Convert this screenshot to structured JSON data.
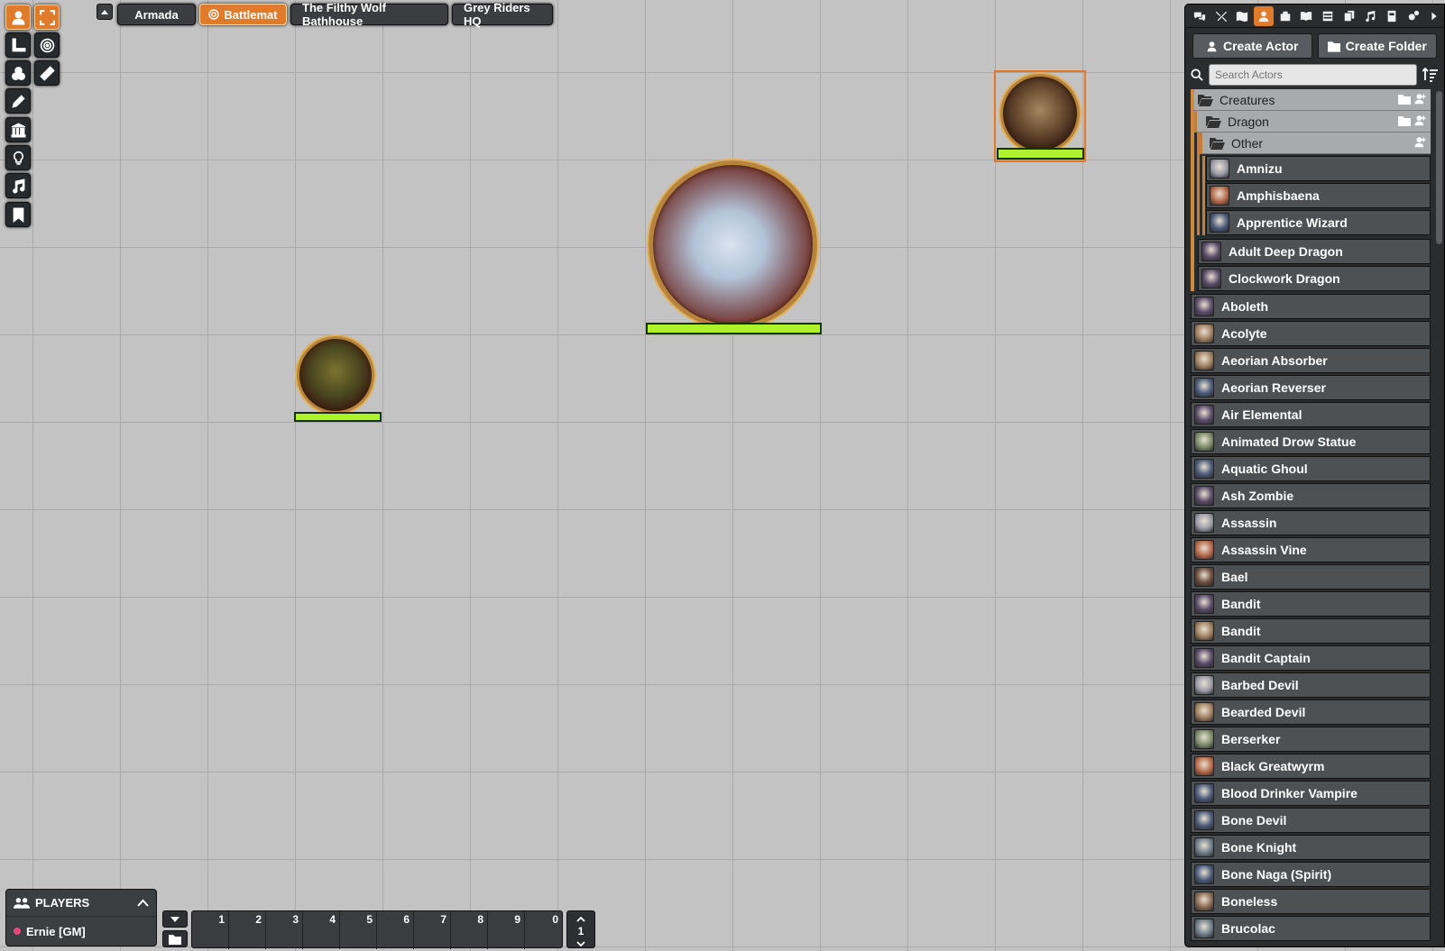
{
  "scene_nav": {
    "tabs": [
      {
        "label": "Armada",
        "active": false
      },
      {
        "label": "Battlemat",
        "active": true
      },
      {
        "label": "The Filthy Wolf Bathhouse",
        "active": false
      },
      {
        "label": "Grey Riders HQ",
        "active": false
      }
    ]
  },
  "controls": [
    {
      "icon": "user-icon",
      "active": true
    },
    {
      "icon": "expand-icon",
      "active": true
    },
    {
      "icon": "measure-icon",
      "active": false
    },
    {
      "icon": "target-icon",
      "active": false
    },
    {
      "icon": "shapes-icon",
      "active": false
    },
    {
      "icon": "ruler-icon",
      "active": false
    },
    {
      "icon": "pencil-icon",
      "active": false
    },
    {
      "icon": "landmark-icon",
      "active": false
    },
    {
      "icon": "lightbulb-icon",
      "active": false
    },
    {
      "icon": "music-icon",
      "active": false
    },
    {
      "icon": "bookmark-icon",
      "active": false
    }
  ],
  "sidebar": {
    "tab_icons": [
      "comments-icon",
      "combat-icon",
      "map-icon",
      "actors-icon",
      "items-icon",
      "journal-icon",
      "tables-icon",
      "cards-icon",
      "playlists-icon",
      "compendium-icon",
      "settings-icon",
      "collapse-icon"
    ],
    "active_tab": "actors-icon",
    "create_actor": "Create Actor",
    "create_folder": "Create Folder",
    "search_placeholder": "Search Actors",
    "folders": {
      "creatures": "Creatures",
      "dragon": "Dragon",
      "other": "Other"
    },
    "other_entries": [
      "Amnizu",
      "Amphisbaena",
      "Apprentice Wizard"
    ],
    "dragon_entries": [
      "Adult Deep Dragon",
      "Clockwork Dragon"
    ],
    "creature_entries": [
      "Aboleth",
      "Acolyte",
      "Aeorian Absorber",
      "Aeorian Reverser",
      "Air Elemental",
      "Animated Drow Statue",
      "Aquatic Ghoul",
      "Ash Zombie",
      "Assassin",
      "Assassin Vine",
      "Bael",
      "Bandit",
      "Bandit",
      "Bandit Captain",
      "Barbed Devil",
      "Bearded Devil",
      "Berserker",
      "Black Greatwyrm",
      "Blood Drinker Vampire",
      "Bone Devil",
      "Bone Knight",
      "Bone Naga (Spirit)",
      "Boneless",
      "Brucolac"
    ]
  },
  "players": {
    "title": "PLAYERS",
    "user": "Ernie [GM]",
    "user_color": "#e84a7a"
  },
  "hotbar": {
    "slots": [
      "1",
      "2",
      "3",
      "4",
      "5",
      "6",
      "7",
      "8",
      "9",
      "0"
    ],
    "page": "1"
  },
  "colors": {
    "accent": "#e07b2c",
    "hp_bar": "#aef22a"
  }
}
